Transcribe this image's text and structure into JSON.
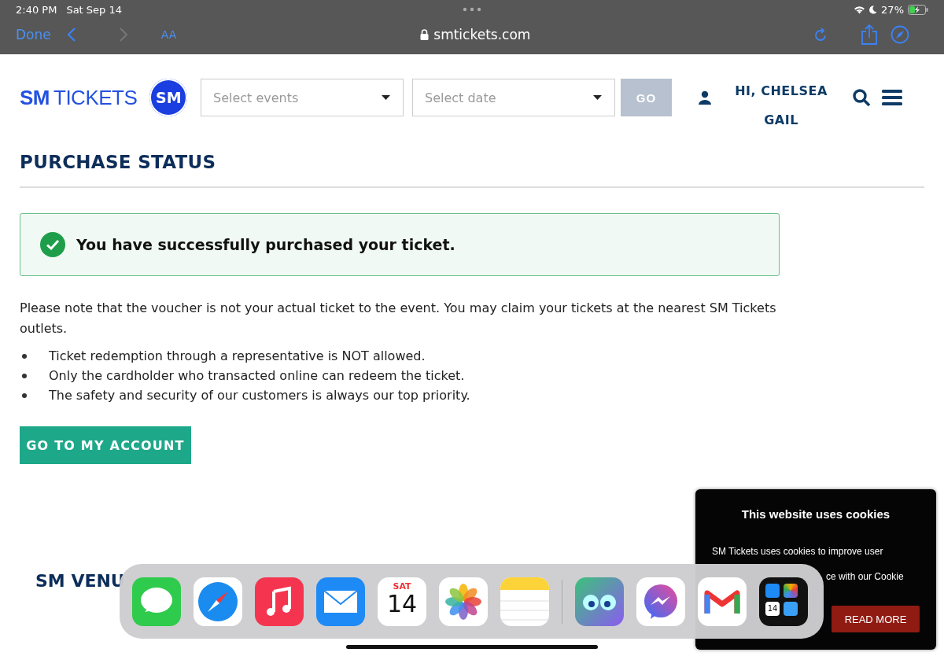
{
  "status_bar": {
    "time": "2:40 PM",
    "date": "Sat Sep 14",
    "battery": "27%"
  },
  "browser": {
    "done": "Done",
    "text_size": "AA",
    "url": "smtickets.com"
  },
  "header": {
    "logo_strong": "SM",
    "logo_rest": "TICKETS",
    "logo_badge": "SM",
    "events": {
      "placeholder": "Select events"
    },
    "date": {
      "placeholder": "Select date"
    },
    "go": "GO",
    "go_disabled": true,
    "user_first": "HI, CHELSEA",
    "user_second": "GAIL"
  },
  "page": {
    "title": "PURCHASE STATUS",
    "success": "You have successfully purchased your ticket.",
    "note": "Please note that the voucher is not your actual ticket to the event. You may claim your tickets at the nearest SM Tickets outlets.",
    "bullets": [
      "Ticket redemption through a representative is NOT allowed.",
      "Only the cardholder who transacted online can redeem the ticket.",
      "The safety and security of our customers is always our top priority."
    ],
    "button": "GO TO MY ACCOUNT",
    "next_heading": "SM VENU"
  },
  "cookie": {
    "title": "This website uses cookies",
    "line_1": "SM Tickets uses cookies to improve user",
    "line_3": "ce with our Cookie",
    "button": "READ MORE"
  },
  "dock": {
    "apps": [
      {
        "kind": "messages"
      },
      {
        "kind": "safari"
      },
      {
        "kind": "music"
      },
      {
        "kind": "mail"
      },
      {
        "kind": "calendar",
        "day": "SAT",
        "date": "14"
      },
      {
        "kind": "photos"
      },
      {
        "kind": "notes"
      },
      {
        "kind": "divider"
      },
      {
        "kind": "owl"
      },
      {
        "kind": "messenger"
      },
      {
        "kind": "gmail"
      },
      {
        "kind": "folder",
        "date": "14"
      }
    ]
  }
}
